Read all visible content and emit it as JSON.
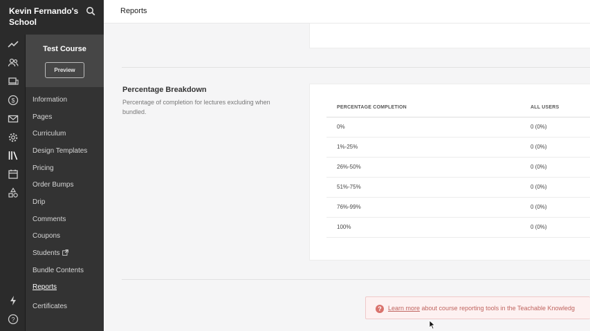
{
  "school": {
    "name": "Kevin Fernando's School"
  },
  "rail_icons": [
    "chart-line-icon",
    "users-icon",
    "devices-icon",
    "dollar-icon",
    "mail-icon",
    "gear-icon",
    "library-icon",
    "calendar-icon",
    "shapes-icon",
    "bolt-icon",
    "help-icon"
  ],
  "course": {
    "title": "Test Course",
    "preview_label": "Preview"
  },
  "nav": {
    "items": [
      {
        "label": "Information"
      },
      {
        "label": "Pages"
      },
      {
        "label": "Curriculum"
      },
      {
        "label": "Design Templates"
      },
      {
        "label": "Pricing"
      },
      {
        "label": "Order Bumps"
      },
      {
        "label": "Drip"
      },
      {
        "label": "Comments"
      },
      {
        "label": "Coupons"
      },
      {
        "label": "Students"
      },
      {
        "label": "Bundle Contents"
      },
      {
        "label": "Reports",
        "active": true
      },
      {
        "label": "Certificates"
      }
    ]
  },
  "header": {
    "title": "Reports"
  },
  "section": {
    "title": "Percentage Breakdown",
    "description": "Percentage of completion for lectures excluding when bundled."
  },
  "table": {
    "columns": [
      "PERCENTAGE COMPLETION",
      "ALL USERS"
    ],
    "rows": [
      {
        "range": "0%",
        "users": "0 (0%)"
      },
      {
        "range": "1%-25%",
        "users": "0 (0%)"
      },
      {
        "range": "26%-50%",
        "users": "0 (0%)"
      },
      {
        "range": "51%-75%",
        "users": "0 (0%)"
      },
      {
        "range": "76%-99%",
        "users": "0 (0%)"
      },
      {
        "range": "100%",
        "users": "0 (0%)"
      }
    ]
  },
  "banner": {
    "link_text": "Learn more",
    "text": " about course reporting tools in the Teachable Knowledg"
  },
  "colors": {
    "sidebar": "#2b2b2b",
    "course_panel": "#333333",
    "banner_text": "#c0645f"
  }
}
